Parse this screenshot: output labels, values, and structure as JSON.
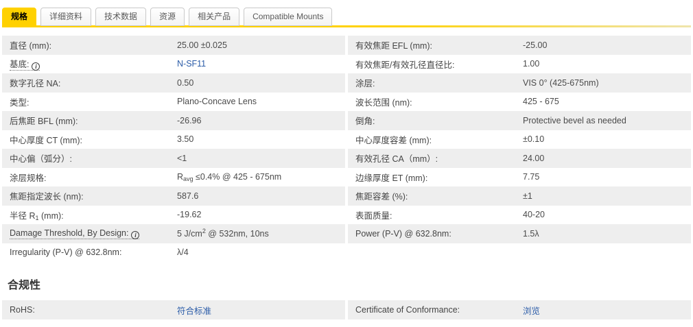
{
  "tabs": [
    {
      "name": "specs",
      "label": "规格",
      "active": true
    },
    {
      "name": "details",
      "label": "详细资料",
      "active": false
    },
    {
      "name": "technical-data",
      "label": "技术数据",
      "active": false
    },
    {
      "name": "resources",
      "label": "资源",
      "active": false
    },
    {
      "name": "related-products",
      "label": "相关产品",
      "active": false
    },
    {
      "name": "compatible-mounts",
      "label": "Compatible Mounts",
      "active": false
    }
  ],
  "spec_rows": [
    {
      "left": {
        "label": "直径 (mm):",
        "value": "25.00 ±0.025"
      },
      "right": {
        "label": "有效焦距 EFL (mm):",
        "value": "-25.00"
      }
    },
    {
      "left": {
        "label": "基底:",
        "info": true,
        "value": "N-SF11",
        "link": true
      },
      "right": {
        "label": "有效焦距/有效孔径直径比:",
        "value": "1.00"
      }
    },
    {
      "left": {
        "label": "数字孔径 NA:",
        "value": "0.50"
      },
      "right": {
        "label": "涂层:",
        "value": "VIS 0° (425-675nm)"
      }
    },
    {
      "left": {
        "label": "类型:",
        "value": "Plano-Concave Lens"
      },
      "right": {
        "label": "波长范围 (nm):",
        "value": "425 - 675"
      }
    },
    {
      "left": {
        "label": "后焦距 BFL (mm):",
        "value": "-26.96"
      },
      "right": {
        "label": "倒角:",
        "value": "Protective bevel as needed"
      }
    },
    {
      "left": {
        "label": "中心厚度 CT (mm):",
        "value": "3.50"
      },
      "right": {
        "label": "中心厚度容差 (mm):",
        "value": "±0.10"
      }
    },
    {
      "left": {
        "label": "中心偏（弧分）:",
        "value": "<1"
      },
      "right": {
        "label": "有效孔径 CA（mm）:",
        "value": "24.00"
      }
    },
    {
      "left": {
        "label": "涂层规格:",
        "value": [
          "R",
          {
            "sub": "avg"
          },
          " ≤0.4% @ 425 - 675nm"
        ]
      },
      "right": {
        "label": "边缘厚度 ET (mm):",
        "value": "7.75"
      }
    },
    {
      "left": {
        "label": "焦距指定波长 (nm):",
        "value": "587.6"
      },
      "right": {
        "label": "焦距容差 (%):",
        "value": "±1"
      }
    },
    {
      "left": {
        "label": [
          "半径 R",
          {
            "sub": "1"
          },
          " (mm):"
        ],
        "value": "-19.62"
      },
      "right": {
        "label": "表面质量:",
        "value": "40-20"
      }
    },
    {
      "left": {
        "label": "Damage Threshold, By Design:",
        "info": true,
        "value": [
          "5 J/cm",
          {
            "sup": "2"
          },
          " @ 532nm, 10ns"
        ]
      },
      "right": {
        "label": "Power (P-V) @ 632.8nm:",
        "value": "1.5λ"
      }
    },
    {
      "left": {
        "label": "Irregularity (P-V) @ 632.8nm:",
        "value": "λ/4"
      },
      "right": null
    }
  ],
  "compliance": {
    "title": "合规性",
    "rows": [
      {
        "left": {
          "label": "RoHS:",
          "value": "符合标准",
          "link": true
        },
        "right": {
          "label": "Certificate of Conformance:",
          "value": "浏览",
          "link": true
        }
      }
    ]
  },
  "colors": {
    "accent_yellow": "#FFD100",
    "row_gray": "#EEEEEE",
    "link_blue": "#2B5CA8",
    "text": "#4A4A4A",
    "tab_border": "#C9C9C9"
  }
}
